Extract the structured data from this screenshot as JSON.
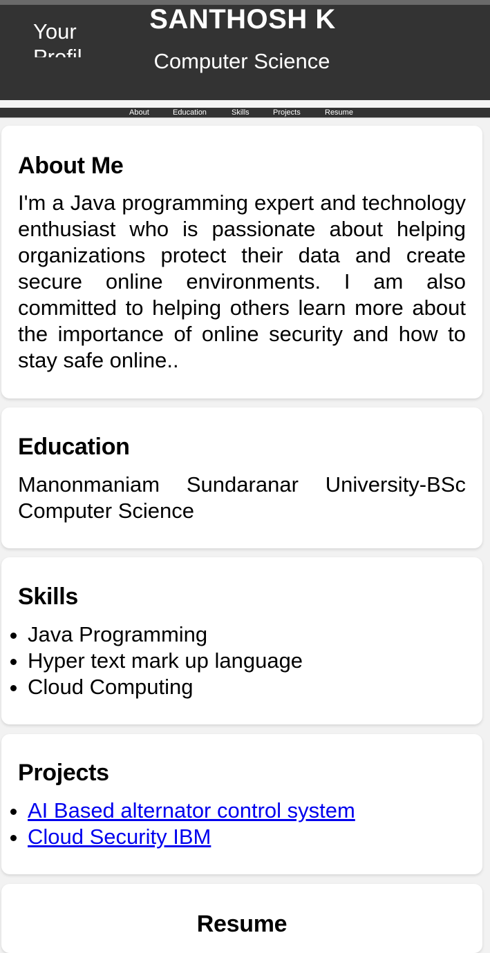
{
  "header": {
    "avatar_alt": "Your Profile",
    "name": "SANTHOSH K",
    "subtitle": "Computer Science"
  },
  "nav": {
    "items": [
      {
        "label": "About"
      },
      {
        "label": "Education"
      },
      {
        "label": "Skills"
      },
      {
        "label": "Projects"
      },
      {
        "label": "Resume"
      }
    ]
  },
  "about": {
    "title": "About Me",
    "text": "I'm a Java programming expert and technology enthusiast who is passionate about helping organizations protect their data and create secure online environments. I am also committed to helping others learn more about the importance of online security and how to stay safe online.."
  },
  "education": {
    "title": "Education",
    "text": "Manonmaniam Sundaranar University-BSc Computer Science"
  },
  "skills": {
    "title": "Skills",
    "items": [
      "Java Programming",
      "Hyper text mark up language",
      "Cloud Computing"
    ]
  },
  "projects": {
    "title": "Projects",
    "items": [
      "AI Based alternator control system",
      "Cloud Security IBM"
    ]
  },
  "resume": {
    "title": "Resume"
  }
}
